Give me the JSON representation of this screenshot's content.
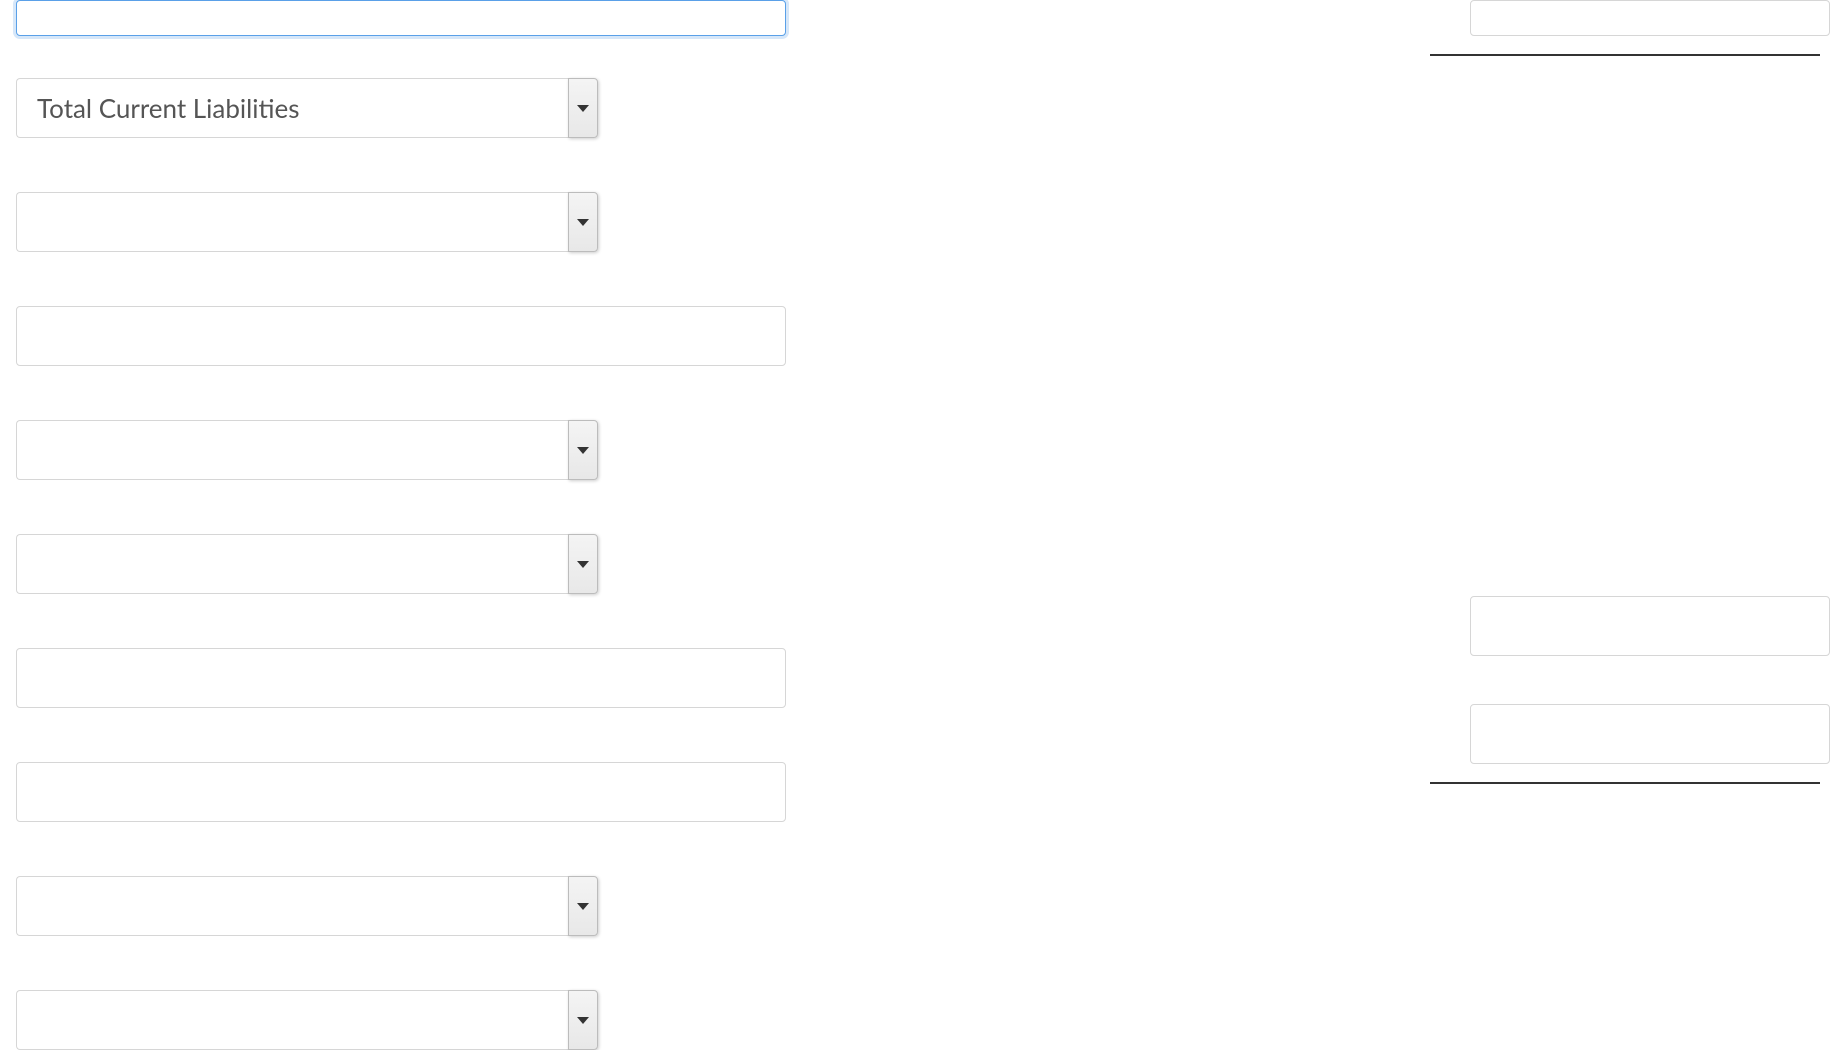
{
  "left": {
    "row1": {
      "type": "text",
      "value": "",
      "focused": true
    },
    "row2": {
      "type": "dropdown",
      "value": "Total Current Liabilities"
    },
    "row3": {
      "type": "dropdown",
      "value": ""
    },
    "row4": {
      "type": "text",
      "value": ""
    },
    "row5": {
      "type": "dropdown",
      "value": ""
    },
    "row6": {
      "type": "dropdown",
      "value": ""
    },
    "row7": {
      "type": "text",
      "value": ""
    },
    "row8": {
      "type": "text",
      "value": ""
    },
    "row9": {
      "type": "dropdown",
      "value": ""
    },
    "row10": {
      "type": "dropdown",
      "value": ""
    }
  },
  "right": {
    "top_box": {
      "value": ""
    },
    "mid_box1": {
      "value": ""
    },
    "mid_box2": {
      "value": ""
    }
  }
}
